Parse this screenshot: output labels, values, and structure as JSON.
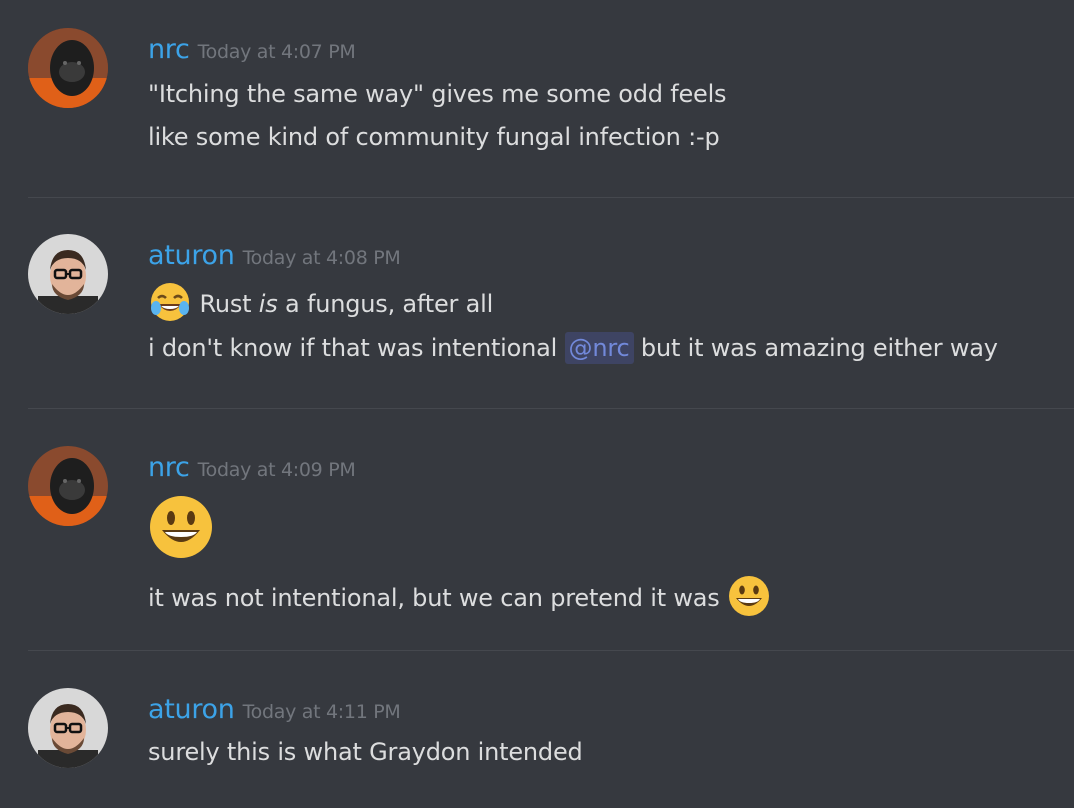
{
  "messages": [
    {
      "username": "nrc",
      "timestamp": "Today at 4:07 PM",
      "avatar": "gorilla-avatar",
      "lines": [
        "\"Itching the same way\" gives me some odd feels",
        "like some kind of community fungal infection :-p"
      ]
    },
    {
      "username": "aturon",
      "timestamp": "Today at 4:08 PM",
      "avatar": "man-glasses-avatar",
      "line1": {
        "emoji": "joy-emoji",
        "before": "Rust ",
        "em": "is",
        "after": " a fungus, after all"
      },
      "line2": {
        "before": "i don't know if that was intentional ",
        "mention": "@nrc",
        "after": " but it was amazing either way"
      }
    },
    {
      "username": "nrc",
      "timestamp": "Today at 4:09 PM",
      "avatar": "gorilla-avatar",
      "big_emoji": "smiley-emoji",
      "line": "it was not intentional, but we can pretend it was",
      "trailing_emoji": "smiley-emoji"
    },
    {
      "username": "aturon",
      "timestamp": "Today at 4:11 PM",
      "avatar": "man-glasses-avatar",
      "line": "surely this is what Graydon intended"
    }
  ],
  "colors": {
    "background": "#36393f",
    "username": "#3ca3e8",
    "timestamp": "#72767d",
    "text": "#dcddde",
    "mention_bg": "#3e4463",
    "mention_text": "#7289da"
  }
}
